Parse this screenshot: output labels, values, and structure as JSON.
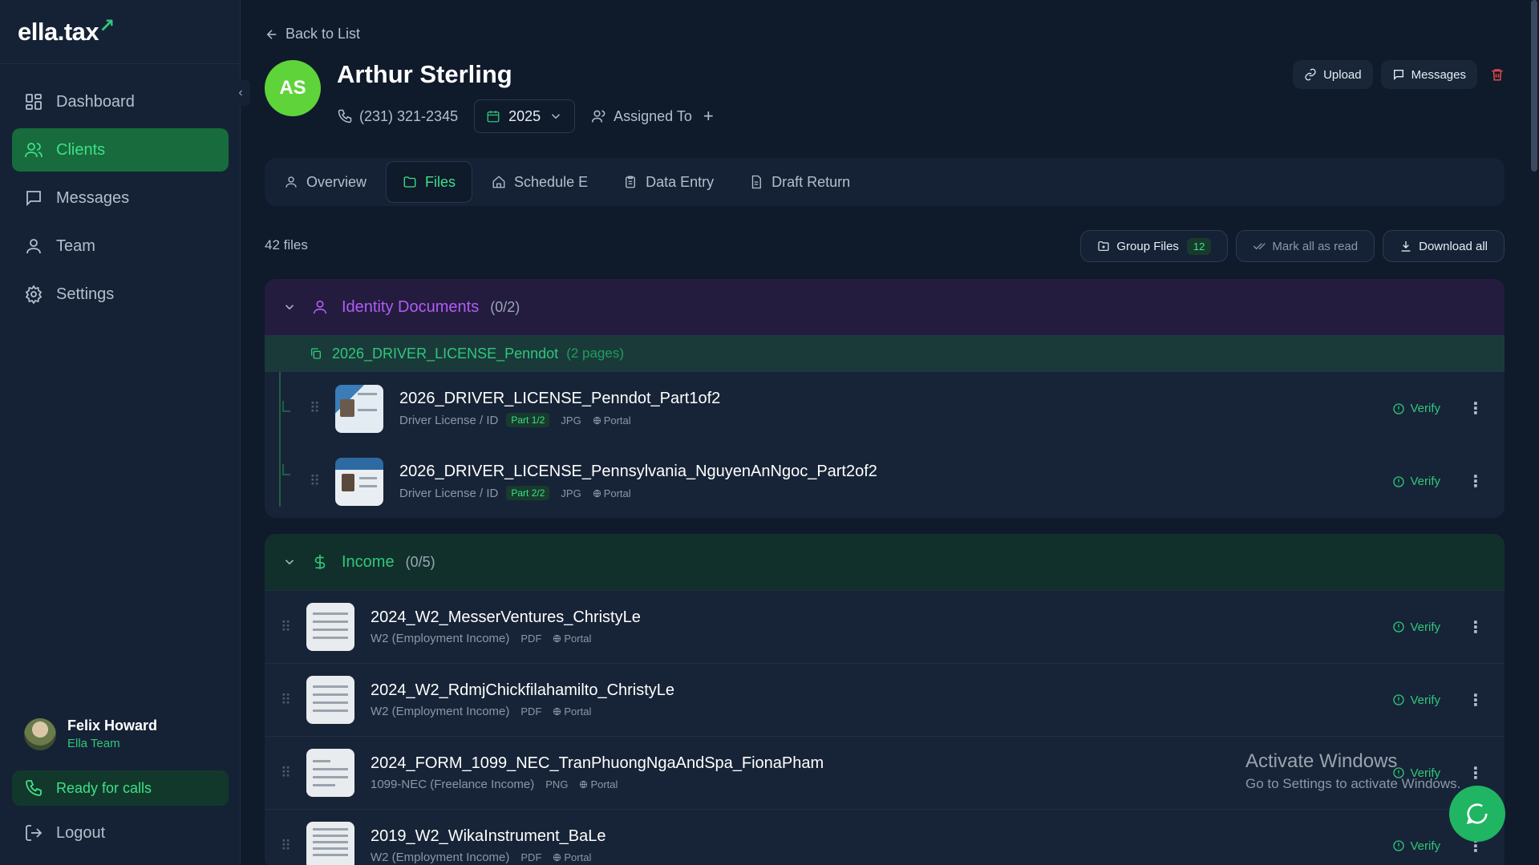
{
  "app": {
    "logo": "ella.tax"
  },
  "sidebar": {
    "items": [
      {
        "label": "Dashboard",
        "icon": "dashboard-icon"
      },
      {
        "label": "Clients",
        "icon": "users-icon",
        "active": true
      },
      {
        "label": "Messages",
        "icon": "message-icon"
      },
      {
        "label": "Team",
        "icon": "team-icon"
      },
      {
        "label": "Settings",
        "icon": "gear-icon"
      }
    ],
    "user": {
      "name": "Felix Howard",
      "team": "Ella Team"
    },
    "ready_label": "Ready for calls",
    "logout_label": "Logout"
  },
  "header": {
    "back_label": "Back to List",
    "initials": "AS",
    "client_name": "Arthur Sterling",
    "phone": "(231) 321-2345",
    "year": "2025",
    "assigned_label": "Assigned To",
    "upload_label": "Upload",
    "messages_label": "Messages"
  },
  "tabs": [
    {
      "label": "Overview"
    },
    {
      "label": "Files",
      "active": true
    },
    {
      "label": "Schedule E"
    },
    {
      "label": "Data Entry"
    },
    {
      "label": "Draft Return"
    }
  ],
  "files": {
    "count_label": "42 files",
    "group_files_label": "Group Files",
    "group_files_count": "12",
    "mark_read_label": "Mark all as read",
    "download_label": "Download all"
  },
  "groups": {
    "identity": {
      "title": "Identity Documents",
      "count": "(0/2)",
      "bundle": {
        "name": "2026_DRIVER_LICENSE_Penndot",
        "pages": "(2 pages)"
      },
      "files": [
        {
          "name": "2026_DRIVER_LICENSE_Penndot_Part1of2",
          "type": "Driver License / ID",
          "part": "Part 1/2",
          "ext": "JPG",
          "source": "Portal"
        },
        {
          "name": "2026_DRIVER_LICENSE_Pennsylvania_NguyenAnNgoc_Part2of2",
          "type": "Driver License / ID",
          "part": "Part 2/2",
          "ext": "JPG",
          "source": "Portal"
        }
      ]
    },
    "income": {
      "title": "Income",
      "count": "(0/5)",
      "files": [
        {
          "name": "2024_W2_MesserVentures_ChristyLe",
          "type": "W2 (Employment Income)",
          "ext": "PDF",
          "source": "Portal"
        },
        {
          "name": "2024_W2_RdmjChickfilahamilto_ChristyLe",
          "type": "W2 (Employment Income)",
          "ext": "PDF",
          "source": "Portal"
        },
        {
          "name": "2024_FORM_1099_NEC_TranPhuongNgaAndSpa_FionaPham",
          "type": "1099-NEC (Freelance Income)",
          "ext": "PNG",
          "source": "Portal"
        },
        {
          "name": "2019_W2_WikaInstrument_BaLe",
          "type": "W2 (Employment Income)",
          "ext": "PDF",
          "source": "Portal"
        }
      ]
    }
  },
  "verify_label": "Verify",
  "watermark": {
    "line1": "Activate Windows",
    "line2": "Go to Settings to activate Windows."
  },
  "colors": {
    "accent": "#2fc77a",
    "identity": "#b05cf5",
    "danger": "#e5484d",
    "bg": "#0f1a2b"
  }
}
